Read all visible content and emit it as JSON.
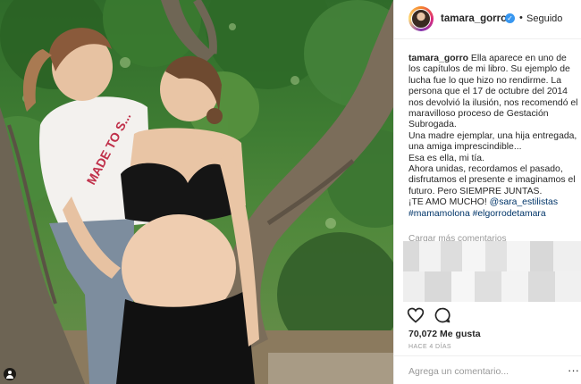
{
  "post": {
    "username": "tamara_gorro",
    "follow_separator": "•",
    "follow_status": "Seguido",
    "caption": {
      "user": "tamara_gorro",
      "text1": "Ella aparece en uno de los capítulos de mi libro. Su ejemplo de lucha fue lo que hizo no rendirme. La persona que el 17 de octubre del 2014 nos devolvió la ilusión, nos recomendó el maravilloso proceso de Gestación Subrogada.",
      "text2": "Una madre ejemplar, una hija entregada, una amiga imprescindible...",
      "text3": "Esa es ella, mi tía.",
      "text4": "Ahora unidas, recordamos el pasado, disfrutamos el presente e imaginamos el futuro. Pero SIEMPRE JUNTAS.",
      "text5_prefix": "¡TE AMO MUCHO!",
      "mention": "@sara_estilistas",
      "hashtag1": "#mamamolona",
      "hashtag2": "#elgorrodetamara"
    },
    "more_comments": "Cargar más comentarios",
    "likes": "70,072 Me gusta",
    "time": "HACE 4 DÍAS",
    "comment_placeholder": "Agrega un comentario...",
    "more_options": "···",
    "shirt_text": "MADE TO S..."
  },
  "icons": {
    "like": "heart-icon",
    "comment": "comment-bubble-icon",
    "verified": "verified-badge-icon",
    "user_tag": "user-tag-icon"
  },
  "colors": {
    "verified": "#3897f0",
    "link": "#003569",
    "secondary_text": "#999999",
    "primary_text": "#262626"
  }
}
